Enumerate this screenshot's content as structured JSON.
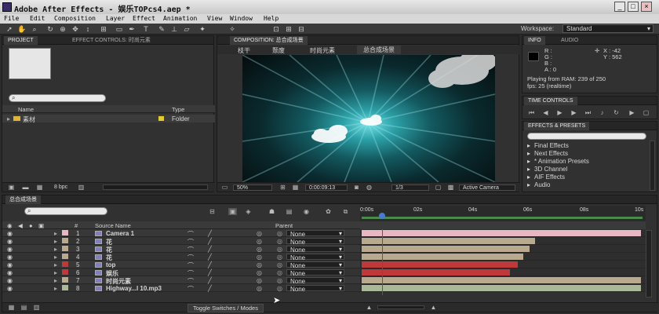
{
  "window": {
    "title": "Adobe After Effects - 娱乐TOPcs4.aep *",
    "minimize": "_",
    "maximize": "□",
    "close": "×"
  },
  "menu": [
    "File",
    "Edit",
    "Composition",
    "Layer",
    "Effect",
    "Animation",
    "View",
    "Window",
    "Help"
  ],
  "toolbar": {
    "workspace_label": "Workspace:",
    "workspace_value": "Standard"
  },
  "project": {
    "tab_project": "PROJECT",
    "tab_effect_controls": "EFFECT CONTROLS: 时尚元素",
    "col_name": "Name",
    "col_type": "Type",
    "items": [
      {
        "name": "素材",
        "type": "Folder"
      }
    ],
    "bpc": "8 bpc"
  },
  "composition": {
    "tab": "COMPOSITION: 总合成场景",
    "breadcrumbs": [
      "枝干",
      "颓废",
      "时尚元素",
      "总合成场景"
    ],
    "zoom": "50%",
    "timecode": "0:00:09:13",
    "resolution": "1/3",
    "camera": "Active Camera"
  },
  "info": {
    "tab_info": "INFO",
    "tab_audio": "AUDIO",
    "r": "R :",
    "g": "G :",
    "b": "B :",
    "a": "A : 0",
    "x": "X : -42",
    "y": "Y : 562",
    "playing": "Playing from RAM: 239 of 250",
    "fps": "fps: 25 (realtime)"
  },
  "time_controls": {
    "tab": "TIME CONTROLS"
  },
  "effects_presets": {
    "tab": "EFFECTS & PRESETS",
    "items": [
      "Final Effects",
      "Next Effects",
      "* Animation Presets",
      "3D Channel",
      "AIF Effects",
      "Audio"
    ]
  },
  "timeline": {
    "tab": "总合成场景",
    "col_number": "#",
    "col_source": "Source Name",
    "col_parent": "Parent",
    "ruler": [
      "0:00s",
      "02s",
      "04s",
      "06s",
      "08s",
      "10s"
    ],
    "layers": [
      {
        "num": "1",
        "name": "Camera 1",
        "parent": "None",
        "color": "#e8b7c4",
        "start": 0.0,
        "end": 1.0
      },
      {
        "num": "2",
        "name": "花",
        "parent": "None",
        "color": "#b9a98e",
        "start": 0.0,
        "end": 0.62
      },
      {
        "num": "3",
        "name": "花",
        "parent": "None",
        "color": "#b9a98e",
        "start": 0.0,
        "end": 0.6
      },
      {
        "num": "4",
        "name": "花",
        "parent": "None",
        "color": "#b9a98e",
        "start": 0.0,
        "end": 0.58
      },
      {
        "num": "5",
        "name": "top",
        "parent": "None",
        "color": "#c0393a",
        "start": 0.0,
        "end": 0.56
      },
      {
        "num": "6",
        "name": "娱乐",
        "parent": "None",
        "color": "#c0393a",
        "start": 0.0,
        "end": 0.53
      },
      {
        "num": "7",
        "name": "时尚元素",
        "parent": "None",
        "color": "#b9a98e",
        "start": 0.0,
        "end": 1.0
      },
      {
        "num": "8",
        "name": "Highway...l 10.mp3",
        "parent": "None",
        "color": "#aab89a",
        "start": 0.0,
        "end": 1.0
      }
    ],
    "toggle": "Toggle Switches / Modes"
  },
  "colors": {
    "label_pink": "#e8b7c4",
    "label_tan": "#b9a98e",
    "label_red": "#c0393a",
    "playhead": "#e02020"
  }
}
